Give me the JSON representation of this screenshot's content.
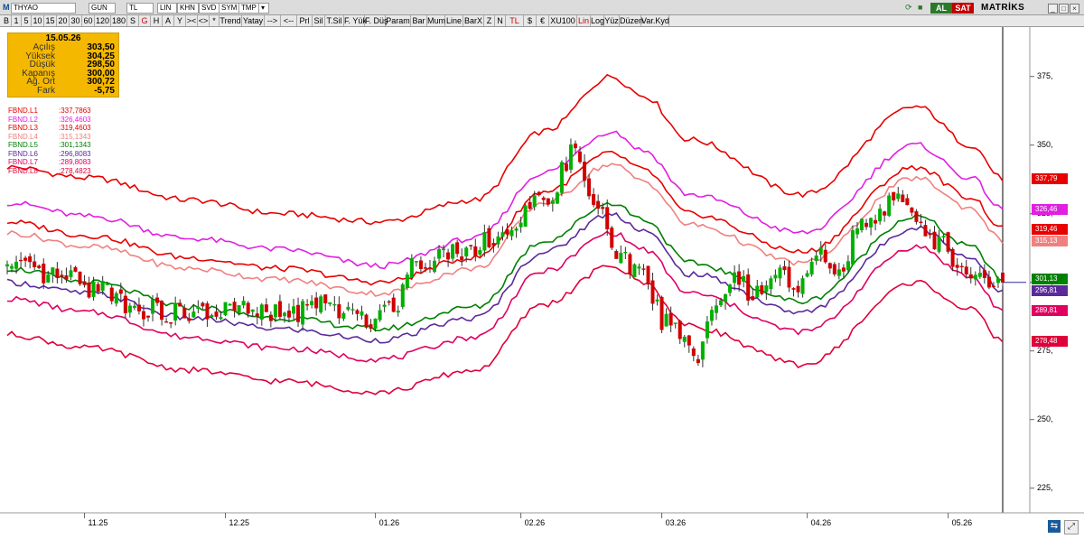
{
  "toolbar": {
    "symbol": "THYAO",
    "period": "GUN",
    "currency": "TL",
    "scale": "LIN",
    "btn_khn": "KHN",
    "btn_svd": "SVD",
    "btn_sym": "SYM",
    "btn_tmp": "TMP",
    "al": "AL",
    "sat": "SAT",
    "brand": "MATRİKS"
  },
  "toolbar2": [
    "B",
    "1",
    "5",
    "10",
    "15",
    "20",
    "30",
    "60",
    "120",
    "180",
    "S",
    "G",
    "H",
    "A",
    "Y",
    "><",
    "<>",
    "*",
    "Trend",
    "Yatay",
    "-->",
    "<--",
    "Prl",
    "Sil",
    "T.Sil",
    "F. Yük",
    "F. Düş",
    "Param",
    "Bar",
    "Mum",
    "Line",
    "BarX",
    "Z",
    "N",
    "TL",
    "$",
    "€",
    "XU100",
    "Lin",
    "Log",
    "Yüz",
    "Düzen",
    "Var.Kyd"
  ],
  "info": {
    "date": "15.05.26",
    "rows": [
      {
        "label": "Açılış",
        "value": "303,50"
      },
      {
        "label": "Yüksek",
        "value": "304,25"
      },
      {
        "label": "Düşük",
        "value": "298,50"
      },
      {
        "label": "Kapanış",
        "value": "300,00"
      },
      {
        "label": "Ağ. Ort",
        "value": "300,72"
      },
      {
        "label": "Fark",
        "value": "-5,75"
      }
    ]
  },
  "legend": [
    {
      "name": "FBND.L1",
      "value": ":337,7863",
      "color": "#e80000"
    },
    {
      "name": "FBND.L2",
      "value": ":326,4603",
      "color": "#e020e0"
    },
    {
      "name": "FBND.L3",
      "value": ":319,4603",
      "color": "#e80000"
    },
    {
      "name": "FBND.L4",
      "value": ":315,1343",
      "color": "#f08080"
    },
    {
      "name": "FBND.L5",
      "value": ":301,1343",
      "color": "#008000"
    },
    {
      "name": "FBND.L6",
      "value": ":296,8083",
      "color": "#5a2a9a"
    },
    {
      "name": "FBND.L7",
      "value": ":289,8083",
      "color": "#e00060"
    },
    {
      "name": "FBND.L8",
      "value": ":278,4823",
      "color": "#e0003a"
    }
  ],
  "tags": [
    {
      "text": "337,79",
      "bg": "#e80000",
      "value": 337.79
    },
    {
      "text": "326,46",
      "bg": "#e020e0",
      "value": 326.46
    },
    {
      "text": "319,46",
      "bg": "#e80000",
      "value": 319.46
    },
    {
      "text": "315,13",
      "bg": "#f08080",
      "value": 315.13
    },
    {
      "text": "301,13",
      "bg": "#008000",
      "value": 301.13
    },
    {
      "text": "296,81",
      "bg": "#5a2a9a",
      "value": 296.81
    },
    {
      "text": "289,81",
      "bg": "#e00060",
      "value": 289.81
    },
    {
      "text": "278,48",
      "bg": "#e0003a",
      "value": 278.48
    }
  ],
  "chart_data": {
    "type": "candlestick",
    "yticks": [
      225,
      250,
      275,
      300,
      325,
      350,
      375
    ],
    "ytick_labels": [
      "225,",
      "250,",
      "275,",
      "300,",
      "325,",
      "350,",
      "375,"
    ],
    "ylim": [
      217,
      393
    ],
    "xtick_labels": [
      "11.25",
      "12.25",
      "01.26",
      "02.26",
      "03.26",
      "04.26",
      "05.26"
    ],
    "xtick_index": [
      17,
      48,
      81,
      113,
      144,
      176,
      207
    ],
    "n_bars": 220,
    "band_colors": [
      "#e80000",
      "#e020e0",
      "#e80000",
      "#f08080",
      "#008000",
      "#5a2a9a",
      "#e00060",
      "#e0003a"
    ],
    "bands": [
      {
        "name": "FBND.L1",
        "index": [
          0,
          18,
          40,
          60,
          82,
          103,
          118,
          133,
          140,
          150,
          175,
          200,
          212,
          219
        ],
        "values": [
          342,
          338,
          330,
          325,
          322,
          330,
          355,
          375,
          368,
          352,
          332,
          364,
          350,
          337.79
        ]
      },
      {
        "name": "FBND.L2",
        "index": [
          0,
          18,
          40,
          60,
          82,
          103,
          118,
          133,
          140,
          150,
          175,
          200,
          212,
          219
        ],
        "values": [
          329,
          324,
          316,
          312,
          306,
          316,
          340,
          355,
          348,
          332,
          318,
          350,
          338,
          326.46
        ]
      },
      {
        "name": "FBND.L3",
        "index": [
          0,
          18,
          40,
          60,
          82,
          103,
          118,
          133,
          140,
          150,
          175,
          200,
          212,
          219
        ],
        "values": [
          322,
          317,
          309,
          305,
          300,
          309,
          333,
          347,
          341,
          325,
          311,
          342,
          331,
          319.46
        ]
      },
      {
        "name": "FBND.L4",
        "index": [
          0,
          18,
          40,
          60,
          82,
          103,
          118,
          133,
          140,
          150,
          175,
          200,
          212,
          219
        ],
        "values": [
          318,
          313,
          305,
          301,
          296,
          305,
          329,
          343,
          337,
          321,
          307,
          338,
          327,
          315.13
        ]
      },
      {
        "name": "FBND.L5",
        "index": [
          0,
          18,
          40,
          60,
          82,
          103,
          118,
          133,
          140,
          150,
          175,
          200,
          212,
          219
        ],
        "values": [
          305,
          300,
          291,
          287,
          283,
          291,
          315,
          329,
          323,
          307,
          293,
          324,
          313,
          301.13
        ]
      },
      {
        "name": "FBND.L6",
        "index": [
          0,
          18,
          40,
          60,
          82,
          103,
          118,
          133,
          140,
          150,
          175,
          200,
          212,
          219
        ],
        "values": [
          300,
          296,
          287,
          283,
          279,
          287,
          311,
          325,
          319,
          303,
          289,
          320,
          309,
          296.81
        ]
      },
      {
        "name": "FBND.L7",
        "index": [
          0,
          18,
          40,
          60,
          82,
          103,
          118,
          133,
          140,
          150,
          175,
          200,
          212,
          219
        ],
        "values": [
          294,
          289,
          280,
          276,
          272,
          280,
          304,
          318,
          312,
          296,
          282,
          313,
          302,
          289.81
        ]
      },
      {
        "name": "FBND.L8",
        "index": [
          0,
          18,
          40,
          60,
          82,
          103,
          118,
          133,
          140,
          150,
          175,
          200,
          212,
          219
        ],
        "values": [
          281,
          276,
          268,
          264,
          260,
          268,
          292,
          306,
          300,
          284,
          270,
          300,
          290,
          278.48
        ]
      }
    ],
    "price_path": {
      "index": [
        0,
        10,
        20,
        30,
        40,
        50,
        60,
        70,
        78,
        85,
        90,
        100,
        110,
        118,
        125,
        130,
        135,
        140,
        145,
        150,
        152,
        155,
        160,
        165,
        170,
        175,
        178,
        182,
        190,
        195,
        200,
        205,
        210,
        215,
        219
      ],
      "values": [
        305,
        302,
        298,
        290,
        288,
        290,
        288,
        292,
        286,
        292,
        308,
        312,
        318,
        330,
        347,
        325,
        308,
        302,
        285,
        280,
        270,
        290,
        300,
        295,
        302,
        298,
        312,
        305,
        325,
        330,
        322,
        315,
        305,
        301,
        300
      ]
    },
    "last_close": 300.0,
    "last_open": 303.5,
    "last_high": 304.25,
    "last_low": 298.5
  }
}
